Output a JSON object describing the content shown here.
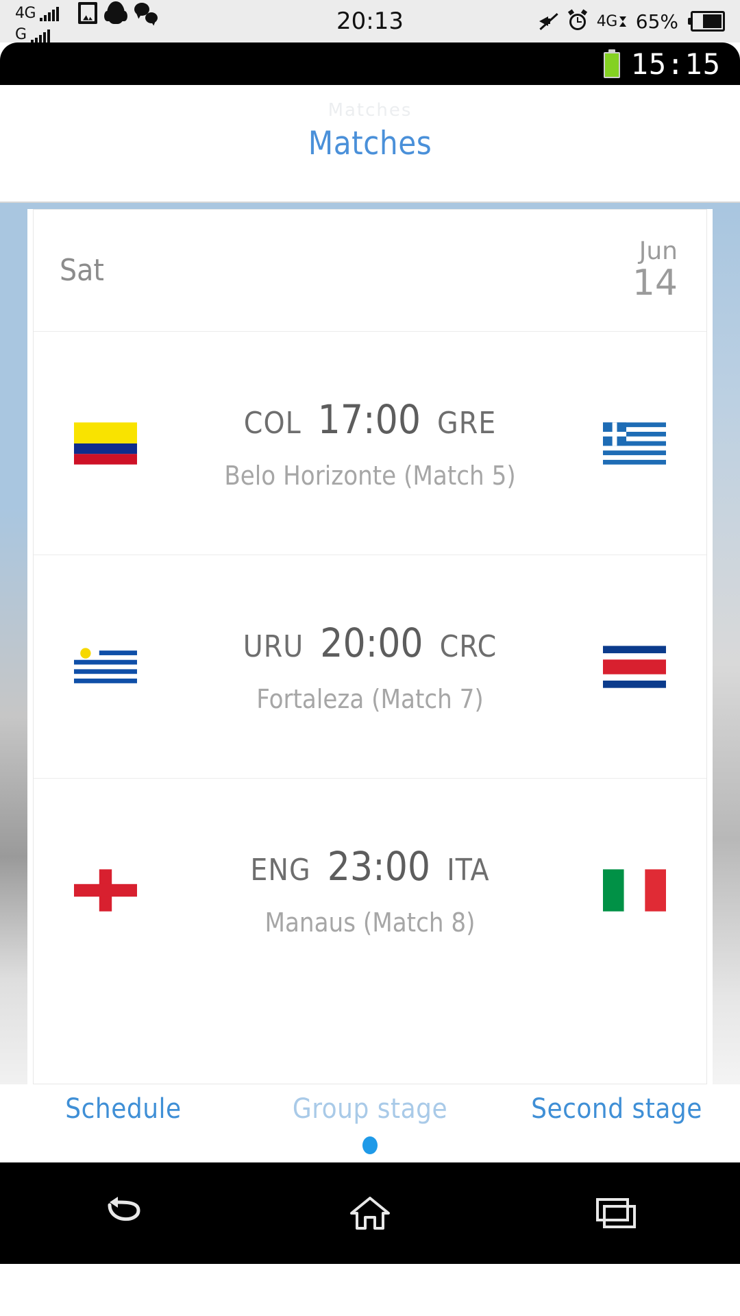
{
  "system_bar": {
    "network_primary": "4G",
    "network_secondary": "G",
    "clock": "20:13",
    "battery_percent": "65%",
    "data_indicator": "4G",
    "icons": [
      "photo-icon",
      "qq-penguin-icon",
      "wechat-icon",
      "mute-icon",
      "alarm-icon",
      "data-transfer-icon",
      "battery-icon"
    ]
  },
  "inner_status_bar": {
    "clock": "15:15",
    "battery_icon": "battery-full-icon"
  },
  "app": {
    "title": "Matches",
    "title_color": "#4a90d9",
    "ghost_title": "Matches"
  },
  "schedule": {
    "date_header": {
      "day": "Sat",
      "month": "Jun",
      "day_number": "14"
    },
    "matches": [
      {
        "home_code": "COL",
        "away_code": "GRE",
        "time": "17:00",
        "venue": "Belo Horizonte (Match  5)",
        "home_flag": "colombia-flag",
        "away_flag": "greece-flag"
      },
      {
        "home_code": "URU",
        "away_code": "CRC",
        "time": "20:00",
        "venue": "Fortaleza (Match  7)",
        "home_flag": "uruguay-flag",
        "away_flag": "costa-rica-flag"
      },
      {
        "home_code": "ENG",
        "away_code": "ITA",
        "time": "23:00",
        "venue": "Manaus (Match  8)",
        "home_flag": "england-flag",
        "away_flag": "italy-flag"
      }
    ]
  },
  "bottom_tabs": {
    "items": [
      {
        "label": "Schedule",
        "state": "active"
      },
      {
        "label": "Group stage",
        "state": "dim"
      },
      {
        "label": "Second stage",
        "state": "active"
      }
    ],
    "active_color": "#3f8fd6",
    "dim_color": "#a9cae8",
    "page_dot_color": "#1f9ae8"
  },
  "navigation_bar": {
    "buttons": [
      "back-icon",
      "home-icon",
      "recent-apps-icon"
    ]
  }
}
